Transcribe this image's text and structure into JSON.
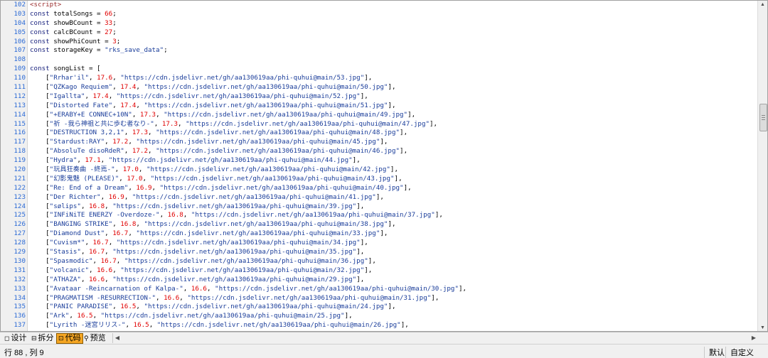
{
  "editor": {
    "lines": [
      {
        "n": "102",
        "tokens": [
          [
            "tag",
            "<script>"
          ]
        ]
      },
      {
        "n": "103",
        "tokens": [
          [
            "kw",
            "const"
          ],
          [
            "id",
            " totalSongs = "
          ],
          [
            "num",
            "66"
          ],
          [
            "punc",
            ";"
          ]
        ]
      },
      {
        "n": "104",
        "tokens": [
          [
            "kw",
            "const"
          ],
          [
            "id",
            " showBCount = "
          ],
          [
            "num",
            "33"
          ],
          [
            "punc",
            ";"
          ]
        ]
      },
      {
        "n": "105",
        "tokens": [
          [
            "kw",
            "const"
          ],
          [
            "id",
            " calcBCount = "
          ],
          [
            "num",
            "27"
          ],
          [
            "punc",
            ";"
          ]
        ]
      },
      {
        "n": "106",
        "tokens": [
          [
            "kw",
            "const"
          ],
          [
            "id",
            " showPhiCount = "
          ],
          [
            "num",
            "3"
          ],
          [
            "punc",
            ";"
          ]
        ]
      },
      {
        "n": "107",
        "tokens": [
          [
            "kw",
            "const"
          ],
          [
            "id",
            " storageKey = "
          ],
          [
            "str",
            "\"rks_save_data\""
          ],
          [
            "punc",
            ";"
          ]
        ]
      },
      {
        "n": "108",
        "tokens": []
      },
      {
        "n": "109",
        "tokens": [
          [
            "kw",
            "const"
          ],
          [
            "id",
            " songList = ["
          ]
        ]
      },
      {
        "n": "110",
        "tokens": [
          [
            "punc",
            "    ["
          ],
          [
            "str",
            "\"Rrhar'il\""
          ],
          [
            "punc",
            ", "
          ],
          [
            "num",
            "17.6"
          ],
          [
            "punc",
            ", "
          ],
          [
            "str",
            "\"https://cdn.jsdelivr.net/gh/aa130619aa/phi-quhui@main/53.jpg\""
          ],
          [
            "punc",
            "],"
          ]
        ]
      },
      {
        "n": "111",
        "tokens": [
          [
            "punc",
            "    ["
          ],
          [
            "str",
            "\"QZKago Requiem\""
          ],
          [
            "punc",
            ", "
          ],
          [
            "num",
            "17.4"
          ],
          [
            "punc",
            ", "
          ],
          [
            "str",
            "\"https://cdn.jsdelivr.net/gh/aa130619aa/phi-quhui@main/50.jpg\""
          ],
          [
            "punc",
            "],"
          ]
        ]
      },
      {
        "n": "112",
        "tokens": [
          [
            "punc",
            "    ["
          ],
          [
            "str",
            "\"Igallta\""
          ],
          [
            "punc",
            ", "
          ],
          [
            "num",
            "17.4"
          ],
          [
            "punc",
            ", "
          ],
          [
            "str",
            "\"https://cdn.jsdelivr.net/gh/aa130619aa/phi-quhui@main/52.jpg\""
          ],
          [
            "punc",
            "],"
          ]
        ]
      },
      {
        "n": "113",
        "tokens": [
          [
            "punc",
            "    ["
          ],
          [
            "str",
            "\"Distorted Fate\""
          ],
          [
            "punc",
            ", "
          ],
          [
            "num",
            "17.4"
          ],
          [
            "punc",
            ", "
          ],
          [
            "str",
            "\"https://cdn.jsdelivr.net/gh/aa130619aa/phi-quhui@main/51.jpg\""
          ],
          [
            "punc",
            "],"
          ]
        ]
      },
      {
        "n": "114",
        "tokens": [
          [
            "punc",
            "    ["
          ],
          [
            "str",
            "\"+ERABY+E CONNEC+10N\""
          ],
          [
            "punc",
            ", "
          ],
          [
            "num",
            "17.3"
          ],
          [
            "punc",
            ", "
          ],
          [
            "str",
            "\"https://cdn.jsdelivr.net/gh/aa130619aa/phi-quhui@main/49.jpg\""
          ],
          [
            "punc",
            "],"
          ]
        ]
      },
      {
        "n": "115",
        "tokens": [
          [
            "punc",
            "    ["
          ],
          [
            "str",
            "\"祈 -我ら神祖と共に歩む者なり-\""
          ],
          [
            "punc",
            ", "
          ],
          [
            "num",
            "17.3"
          ],
          [
            "punc",
            ", "
          ],
          [
            "str",
            "\"https://cdn.jsdelivr.net/gh/aa130619aa/phi-quhui@main/47.jpg\""
          ],
          [
            "punc",
            "],"
          ]
        ]
      },
      {
        "n": "116",
        "tokens": [
          [
            "punc",
            "    ["
          ],
          [
            "str",
            "\"DESTRUCTION 3,2,1\""
          ],
          [
            "punc",
            ", "
          ],
          [
            "num",
            "17.3"
          ],
          [
            "punc",
            ", "
          ],
          [
            "str",
            "\"https://cdn.jsdelivr.net/gh/aa130619aa/phi-quhui@main/48.jpg\""
          ],
          [
            "punc",
            "],"
          ]
        ]
      },
      {
        "n": "117",
        "tokens": [
          [
            "punc",
            "    ["
          ],
          [
            "str",
            "\"Stardust:RAY\""
          ],
          [
            "punc",
            ", "
          ],
          [
            "num",
            "17.2"
          ],
          [
            "punc",
            ", "
          ],
          [
            "str",
            "\"https://cdn.jsdelivr.net/gh/aa130619aa/phi-quhui@main/45.jpg\""
          ],
          [
            "punc",
            "],"
          ]
        ]
      },
      {
        "n": "118",
        "tokens": [
          [
            "punc",
            "    ["
          ],
          [
            "str",
            "\"AbsoluTe disoRdeR\""
          ],
          [
            "punc",
            ", "
          ],
          [
            "num",
            "17.2"
          ],
          [
            "punc",
            ", "
          ],
          [
            "str",
            "\"https://cdn.jsdelivr.net/gh/aa130619aa/phi-quhui@main/46.jpg\""
          ],
          [
            "punc",
            "],"
          ]
        ]
      },
      {
        "n": "119",
        "tokens": [
          [
            "punc",
            "    ["
          ],
          [
            "str",
            "\"Hydra\""
          ],
          [
            "punc",
            ", "
          ],
          [
            "num",
            "17.1"
          ],
          [
            "punc",
            ", "
          ],
          [
            "str",
            "\"https://cdn.jsdelivr.net/gh/aa130619aa/phi-quhui@main/44.jpg\""
          ],
          [
            "punc",
            "],"
          ]
        ]
      },
      {
        "n": "120",
        "tokens": [
          [
            "punc",
            "    ["
          ],
          [
            "str",
            "\"玩具狂奏曲 -終焉-\""
          ],
          [
            "punc",
            ", "
          ],
          [
            "num",
            "17.0"
          ],
          [
            "punc",
            ", "
          ],
          [
            "str",
            "\"https://cdn.jsdelivr.net/gh/aa130619aa/phi-quhui@main/42.jpg\""
          ],
          [
            "punc",
            "],"
          ]
        ]
      },
      {
        "n": "121",
        "tokens": [
          [
            "punc",
            "    ["
          ],
          [
            "str",
            "\"幻影鬼魅 (PLEASE)\""
          ],
          [
            "punc",
            ", "
          ],
          [
            "num",
            "17.0"
          ],
          [
            "punc",
            ", "
          ],
          [
            "str",
            "\"https://cdn.jsdelivr.net/gh/aa130619aa/phi-quhui@main/43.jpg\""
          ],
          [
            "punc",
            "],"
          ]
        ]
      },
      {
        "n": "122",
        "tokens": [
          [
            "punc",
            "    ["
          ],
          [
            "str",
            "\"Re: End of a Dream\""
          ],
          [
            "punc",
            ", "
          ],
          [
            "num",
            "16.9"
          ],
          [
            "punc",
            ", "
          ],
          [
            "str",
            "\"https://cdn.jsdelivr.net/gh/aa130619aa/phi-quhui@main/40.jpg\""
          ],
          [
            "punc",
            "],"
          ]
        ]
      },
      {
        "n": "123",
        "tokens": [
          [
            "punc",
            "    ["
          ],
          [
            "str",
            "\"Der Richter\""
          ],
          [
            "punc",
            ", "
          ],
          [
            "num",
            "16.9"
          ],
          [
            "punc",
            ", "
          ],
          [
            "str",
            "\"https://cdn.jsdelivr.net/gh/aa130619aa/phi-quhui@main/41.jpg\""
          ],
          [
            "punc",
            "],"
          ]
        ]
      },
      {
        "n": "124",
        "tokens": [
          [
            "punc",
            "    ["
          ],
          [
            "str",
            "\"sølips\""
          ],
          [
            "punc",
            ", "
          ],
          [
            "num",
            "16.8"
          ],
          [
            "punc",
            ", "
          ],
          [
            "str",
            "\"https://cdn.jsdelivr.net/gh/aa130619aa/phi-quhui@main/39.jpg\""
          ],
          [
            "punc",
            "],"
          ]
        ]
      },
      {
        "n": "125",
        "tokens": [
          [
            "punc",
            "    ["
          ],
          [
            "str",
            "\"INFiNiTE ENERZY -Overdoze-\""
          ],
          [
            "punc",
            ", "
          ],
          [
            "num",
            "16.8"
          ],
          [
            "punc",
            ", "
          ],
          [
            "str",
            "\"https://cdn.jsdelivr.net/gh/aa130619aa/phi-quhui@main/37.jpg\""
          ],
          [
            "punc",
            "],"
          ]
        ]
      },
      {
        "n": "126",
        "tokens": [
          [
            "punc",
            "    ["
          ],
          [
            "str",
            "\"BANGING STRIKE\""
          ],
          [
            "punc",
            ", "
          ],
          [
            "num",
            "16.8"
          ],
          [
            "punc",
            ", "
          ],
          [
            "str",
            "\"https://cdn.jsdelivr.net/gh/aa130619aa/phi-quhui@main/38.jpg\""
          ],
          [
            "punc",
            "],"
          ]
        ]
      },
      {
        "n": "127",
        "tokens": [
          [
            "punc",
            "    ["
          ],
          [
            "str",
            "\"Diamond Dust\""
          ],
          [
            "punc",
            ", "
          ],
          [
            "num",
            "16.7"
          ],
          [
            "punc",
            ", "
          ],
          [
            "str",
            "\"https://cdn.jsdelivr.net/gh/aa130619aa/phi-quhui@main/33.jpg\""
          ],
          [
            "punc",
            "],"
          ]
        ]
      },
      {
        "n": "128",
        "tokens": [
          [
            "punc",
            "    ["
          ],
          [
            "str",
            "\"Cuvism*\""
          ],
          [
            "punc",
            ", "
          ],
          [
            "num",
            "16.7"
          ],
          [
            "punc",
            ", "
          ],
          [
            "str",
            "\"https://cdn.jsdelivr.net/gh/aa130619aa/phi-quhui@main/34.jpg\""
          ],
          [
            "punc",
            "],"
          ]
        ]
      },
      {
        "n": "129",
        "tokens": [
          [
            "punc",
            "    ["
          ],
          [
            "str",
            "\"Stasis\""
          ],
          [
            "punc",
            ", "
          ],
          [
            "num",
            "16.7"
          ],
          [
            "punc",
            ", "
          ],
          [
            "str",
            "\"https://cdn.jsdelivr.net/gh/aa130619aa/phi-quhui@main/35.jpg\""
          ],
          [
            "punc",
            "],"
          ]
        ]
      },
      {
        "n": "130",
        "tokens": [
          [
            "punc",
            "    ["
          ],
          [
            "str",
            "\"Spasmodic\""
          ],
          [
            "punc",
            ", "
          ],
          [
            "num",
            "16.7"
          ],
          [
            "punc",
            ", "
          ],
          [
            "str",
            "\"https://cdn.jsdelivr.net/gh/aa130619aa/phi-quhui@main/36.jpg\""
          ],
          [
            "punc",
            "],"
          ]
        ]
      },
      {
        "n": "131",
        "tokens": [
          [
            "punc",
            "    ["
          ],
          [
            "str",
            "\"volcanic\""
          ],
          [
            "punc",
            ", "
          ],
          [
            "num",
            "16.6"
          ],
          [
            "punc",
            ", "
          ],
          [
            "str",
            "\"https://cdn.jsdelivr.net/gh/aa130619aa/phi-quhui@main/32.jpg\""
          ],
          [
            "punc",
            "],"
          ]
        ]
      },
      {
        "n": "132",
        "tokens": [
          [
            "punc",
            "    ["
          ],
          [
            "str",
            "\"ATHAZA\""
          ],
          [
            "punc",
            ", "
          ],
          [
            "num",
            "16.6"
          ],
          [
            "punc",
            ", "
          ],
          [
            "str",
            "\"https://cdn.jsdelivr.net/gh/aa130619aa/phi-quhui@main/29.jpg\""
          ],
          [
            "punc",
            "],"
          ]
        ]
      },
      {
        "n": "133",
        "tokens": [
          [
            "punc",
            "    ["
          ],
          [
            "str",
            "\"Avataar -Reincarnation of Kalpa-\""
          ],
          [
            "punc",
            ", "
          ],
          [
            "num",
            "16.6"
          ],
          [
            "punc",
            ", "
          ],
          [
            "str",
            "\"https://cdn.jsdelivr.net/gh/aa130619aa/phi-quhui@main/30.jpg\""
          ],
          [
            "punc",
            "],"
          ]
        ]
      },
      {
        "n": "134",
        "tokens": [
          [
            "punc",
            "    ["
          ],
          [
            "str",
            "\"PRAGMATISM -RESURRECTION-\""
          ],
          [
            "punc",
            ", "
          ],
          [
            "num",
            "16.6"
          ],
          [
            "punc",
            ", "
          ],
          [
            "str",
            "\"https://cdn.jsdelivr.net/gh/aa130619aa/phi-quhui@main/31.jpg\""
          ],
          [
            "punc",
            "],"
          ]
        ]
      },
      {
        "n": "135",
        "tokens": [
          [
            "punc",
            "    ["
          ],
          [
            "str",
            "\"PANIC PARADISE\""
          ],
          [
            "punc",
            ", "
          ],
          [
            "num",
            "16.5"
          ],
          [
            "punc",
            ", "
          ],
          [
            "str",
            "\"https://cdn.jsdelivr.net/gh/aa130619aa/phi-quhui@main/24.jpg\""
          ],
          [
            "punc",
            "],"
          ]
        ]
      },
      {
        "n": "136",
        "tokens": [
          [
            "punc",
            "    ["
          ],
          [
            "str",
            "\"Ark\""
          ],
          [
            "punc",
            ", "
          ],
          [
            "num",
            "16.5"
          ],
          [
            "punc",
            ", "
          ],
          [
            "str",
            "\"https://cdn.jsdelivr.net/gh/aa130619aa/phi-quhui@main/25.jpg\""
          ],
          [
            "punc",
            "],"
          ]
        ]
      },
      {
        "n": "137",
        "tokens": [
          [
            "punc",
            "    ["
          ],
          [
            "str",
            "\"Lyrith -迷宮リリス-\""
          ],
          [
            "punc",
            ", "
          ],
          [
            "num",
            "16.5"
          ],
          [
            "punc",
            ", "
          ],
          [
            "str",
            "\"https://cdn.jsdelivr.net/gh/aa130619aa/phi-quhui@main/26.jpg\""
          ],
          [
            "punc",
            "],"
          ]
        ]
      }
    ]
  },
  "tabs": [
    {
      "label": "设计",
      "icon": "design-icon",
      "active": false
    },
    {
      "label": "拆分",
      "icon": "split-icon",
      "active": false
    },
    {
      "label": "代码",
      "icon": "code-icon",
      "active": true
    },
    {
      "label": "预览",
      "icon": "preview-icon",
      "active": false
    }
  ],
  "status": {
    "position": "行 88 , 列 9",
    "encoding": "默认",
    "custom": "自定义"
  },
  "colors": {
    "active_tab": "#f5a623",
    "line_number": "#2b6ad6",
    "number_literal": "#e00000",
    "string_literal": "#1a3d9a",
    "keyword": "#1a237e"
  }
}
